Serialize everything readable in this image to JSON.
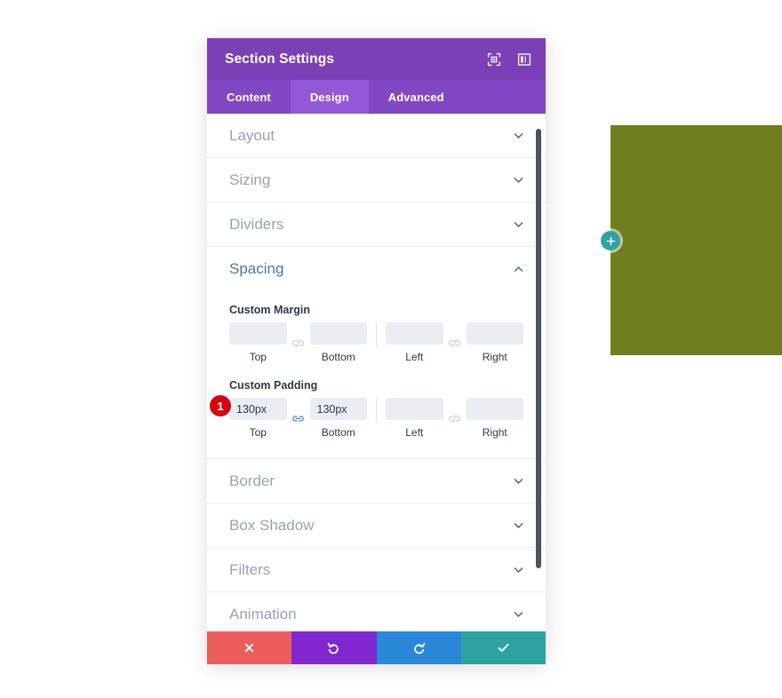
{
  "canvas": {
    "section_color": "#6f7f1f",
    "add_section_button": {
      "icon": "plus-icon",
      "color": "#2ea3a2",
      "label": "+"
    }
  },
  "modal": {
    "title": "Section Settings",
    "header_icons": [
      {
        "name": "focus-target-icon",
        "label": "Focus"
      },
      {
        "name": "panel-layout-icon",
        "label": "Layout"
      }
    ],
    "tabs": [
      {
        "label": "Content",
        "active": false
      },
      {
        "label": "Design",
        "active": true
      },
      {
        "label": "Advanced",
        "active": false
      }
    ],
    "accent_color": "#7b40b5",
    "tab_bar_color": "#8247c4",
    "tab_active_color": "#9258d8",
    "sections": [
      {
        "label": "Layout",
        "open": false
      },
      {
        "label": "Sizing",
        "open": false
      },
      {
        "label": "Dividers",
        "open": false
      },
      {
        "label": "Spacing",
        "open": true
      },
      {
        "label": "Border",
        "open": false
      },
      {
        "label": "Box Shadow",
        "open": false
      },
      {
        "label": "Filters",
        "open": false
      },
      {
        "label": "Animation",
        "open": false
      }
    ],
    "spacing": {
      "custom_margin": {
        "label": "Custom Margin",
        "vertical_link": {
          "state": "unlinked",
          "icon": "broken-link-icon"
        },
        "horizontal_link": {
          "state": "unlinked",
          "icon": "broken-link-icon"
        },
        "fields": [
          {
            "caption": "Top",
            "value": "",
            "placeholder": ""
          },
          {
            "caption": "Bottom",
            "value": "",
            "placeholder": ""
          },
          {
            "caption": "Left",
            "value": "",
            "placeholder": ""
          },
          {
            "caption": "Right",
            "value": "",
            "placeholder": ""
          }
        ]
      },
      "custom_padding": {
        "label": "Custom Padding",
        "vertical_link": {
          "state": "linked",
          "icon": "linked-chain-icon",
          "color": "#2b87da"
        },
        "horizontal_link": {
          "state": "unlinked",
          "icon": "broken-link-icon"
        },
        "fields": [
          {
            "caption": "Top",
            "value": "130px",
            "placeholder": ""
          },
          {
            "caption": "Bottom",
            "value": "130px",
            "placeholder": ""
          },
          {
            "caption": "Left",
            "value": "",
            "placeholder": ""
          },
          {
            "caption": "Right",
            "value": "",
            "placeholder": ""
          }
        ]
      }
    },
    "footer_buttons": [
      {
        "name": "cancel",
        "icon": "close-x-icon",
        "color": "#eb5d5b"
      },
      {
        "name": "undo",
        "icon": "undo-arrow-icon",
        "color": "#8227cf"
      },
      {
        "name": "redo",
        "icon": "redo-arrow-icon",
        "color": "#2b87da"
      },
      {
        "name": "save",
        "icon": "check-icon",
        "color": "#2ea3a2"
      }
    ]
  },
  "annotations": {
    "step_one": "1"
  }
}
